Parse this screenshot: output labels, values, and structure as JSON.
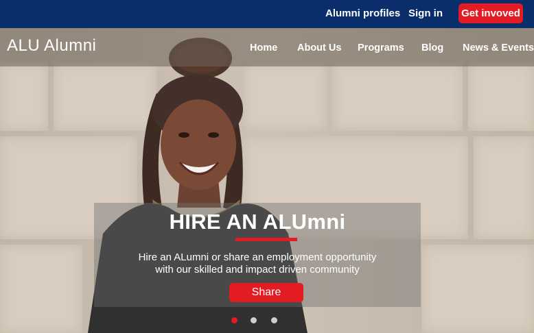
{
  "topbar": {
    "alumni_profiles": "Alumni profiles",
    "sign_in": "Sign in",
    "cta": "Get invoved"
  },
  "brand": {
    "logo": "ALU Alumni"
  },
  "nav": {
    "items": [
      "Home",
      "About Us",
      "Programs",
      "Blog",
      "News & Events"
    ]
  },
  "hero": {
    "title": "HIRE AN ALUmni",
    "line1": "Hire an ALumni or share an employment opportunity",
    "line2": "with our skilled and impact driven community",
    "button": "Share",
    "slides": 3,
    "active_slide": 1
  },
  "colors": {
    "navy": "#0a2e6b",
    "accent_red": "#e31b23"
  }
}
